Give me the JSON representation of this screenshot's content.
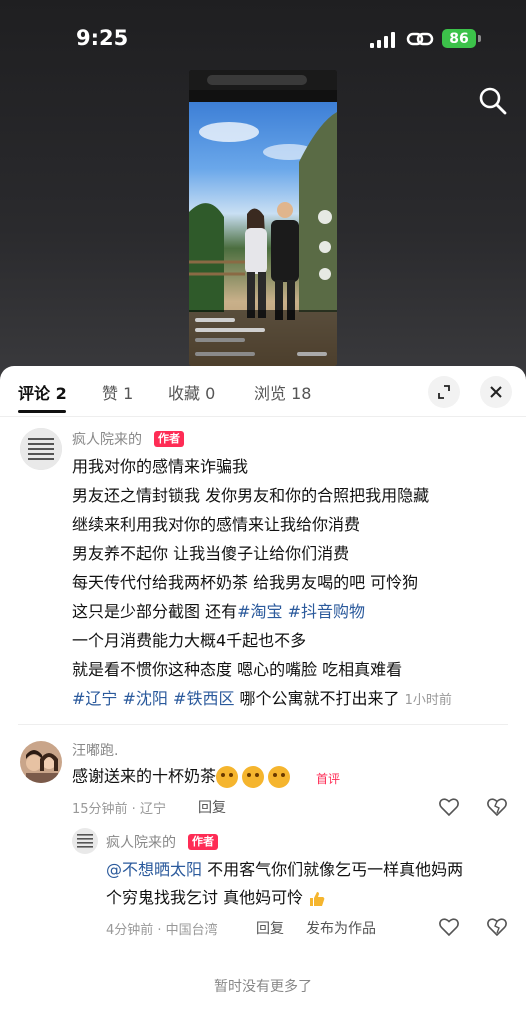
{
  "status_bar": {
    "time": "9:25",
    "battery": "86"
  },
  "tabs": [
    {
      "label": "评论 2"
    },
    {
      "label": "赞 1"
    },
    {
      "label": "收藏 0"
    },
    {
      "label": "浏览 18"
    }
  ],
  "comments": [
    {
      "author": "疯人院来的",
      "badge": "作者",
      "lines": [
        "用我对你的感情来诈骗我",
        "男友还之情封锁我 发你男友和你的合照把我用隐藏",
        "继续来利用我对你的感情来让我给你消费",
        "男友养不起你 让我当傻子让给你们消费",
        "每天传代付给我两杯奶茶 给我男友喝的吧 可怜狗",
        "这只是少部分截图 还有",
        "一个月消费能力大概4千起也不多",
        "就是看不惯你这种态度 嗯心的嘴脸 吃相真难看"
      ],
      "tag_taobao": "#淘宝",
      "tag_douyin": "#抖音购物",
      "tag_liaoning": "#辽宁",
      "tag_shenyang": "#沈阳",
      "tag_tiexi": "#铁西区",
      "last_text": "哪个公寓就不打出来了",
      "time": "1小时前"
    },
    {
      "author": "汪嘟跑.",
      "text": "感谢送来的十杯奶茶",
      "first_label": "首评",
      "meta": "15分钟前 · 辽宁",
      "reply_label": "回复"
    }
  ],
  "reply": {
    "author": "疯人院来的",
    "badge": "作者",
    "mention": "@不想晒太阳",
    "line1": "不用客气你们就像乞丐一样真他妈两",
    "line2": "个穷鬼找我乞讨 真他妈可怜",
    "meta": "4分钟前 · 中国台湾",
    "reply_label": "回复",
    "publish_label": "发布为作品"
  },
  "footer": {
    "no_more": "暂时没有更多了"
  },
  "colors": {
    "accent": "#fe2c55",
    "tag": "#2b5a9c",
    "battery": "#3cc24a"
  },
  "icons": [
    "search-icon",
    "expand-icon",
    "close-icon",
    "heart-icon",
    "dislike-icon",
    "link-icon",
    "signal-icon"
  ]
}
